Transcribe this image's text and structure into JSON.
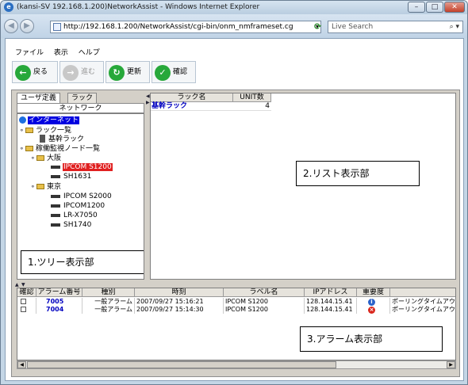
{
  "window": {
    "title": "(kansi-SV 192.168.1.200)NetworkAssist - Windows Internet Explorer",
    "icon": "ie-icon",
    "controls": [
      "minimize",
      "maximize",
      "close"
    ]
  },
  "address_bar": {
    "url": "http://192.168.1.200/NetworkAssist/cgi-bin/onm_nmframeset.cg",
    "search_placeholder": "Live Search"
  },
  "menu": [
    "ファイル",
    "表示",
    "ヘルプ"
  ],
  "toolbar": {
    "back": "戻る",
    "forward": "進む",
    "refresh": "更新",
    "confirm": "確認"
  },
  "tabs": [
    "ユーザ定義",
    "ラック"
  ],
  "tree_header": "ネットワーク",
  "tree": [
    {
      "label": "インターネット",
      "icon": "globe-icon",
      "state": "selected-blue"
    },
    {
      "label": "ラック一覧",
      "icon": "folder-icon"
    },
    {
      "label": "基幹ラック",
      "icon": "rack-icon"
    },
    {
      "label": "稼働監視ノード一覧",
      "icon": "folder-icon"
    },
    {
      "label": "大阪",
      "icon": "folder-icon"
    },
    {
      "label": "IPCOM S1200",
      "icon": "device-icon",
      "state": "selected-red"
    },
    {
      "label": "SH1631",
      "icon": "device-icon"
    },
    {
      "label": "東京",
      "icon": "folder-icon"
    },
    {
      "label": "IPCOM S2000",
      "icon": "device-icon"
    },
    {
      "label": "IPCOM1200",
      "icon": "device-icon"
    },
    {
      "label": "LR-X7050",
      "icon": "device-icon"
    },
    {
      "label": "SH1740",
      "icon": "device-icon"
    }
  ],
  "list": {
    "columns": [
      "ラック名",
      "UNIT数"
    ],
    "rows": [
      {
        "name": "基幹ラック",
        "units": "4"
      }
    ]
  },
  "alarm": {
    "columns": [
      "確認",
      "アラーム番号",
      "種別",
      "時刻",
      "ラベル名",
      "IPアドレス",
      "重要度",
      ""
    ],
    "rows": [
      {
        "no": "7005",
        "type": "一般アラーム",
        "time": "2007/09/27 15:16:21",
        "label": "IPCOM S1200",
        "ip": "128.144.15.41",
        "severity": "info",
        "message": "ポーリングタイムアウト"
      },
      {
        "no": "7004",
        "type": "一般アラーム",
        "time": "2007/09/27 15:14:30",
        "label": "IPCOM S1200",
        "ip": "128.144.15.41",
        "severity": "error",
        "message": "ポーリングタイムアウト"
      }
    ]
  },
  "annotations": {
    "tree": "1.ツリー表示部",
    "list": "2.リスト表示部",
    "alarm": "3.アラーム表示部"
  },
  "colors": {
    "tree_selected_blue": "#0000e0",
    "tree_selected_red": "#e02020",
    "link_blue": "#0000c0",
    "severity_info": "#2a62c9",
    "severity_error": "#d9261c"
  }
}
